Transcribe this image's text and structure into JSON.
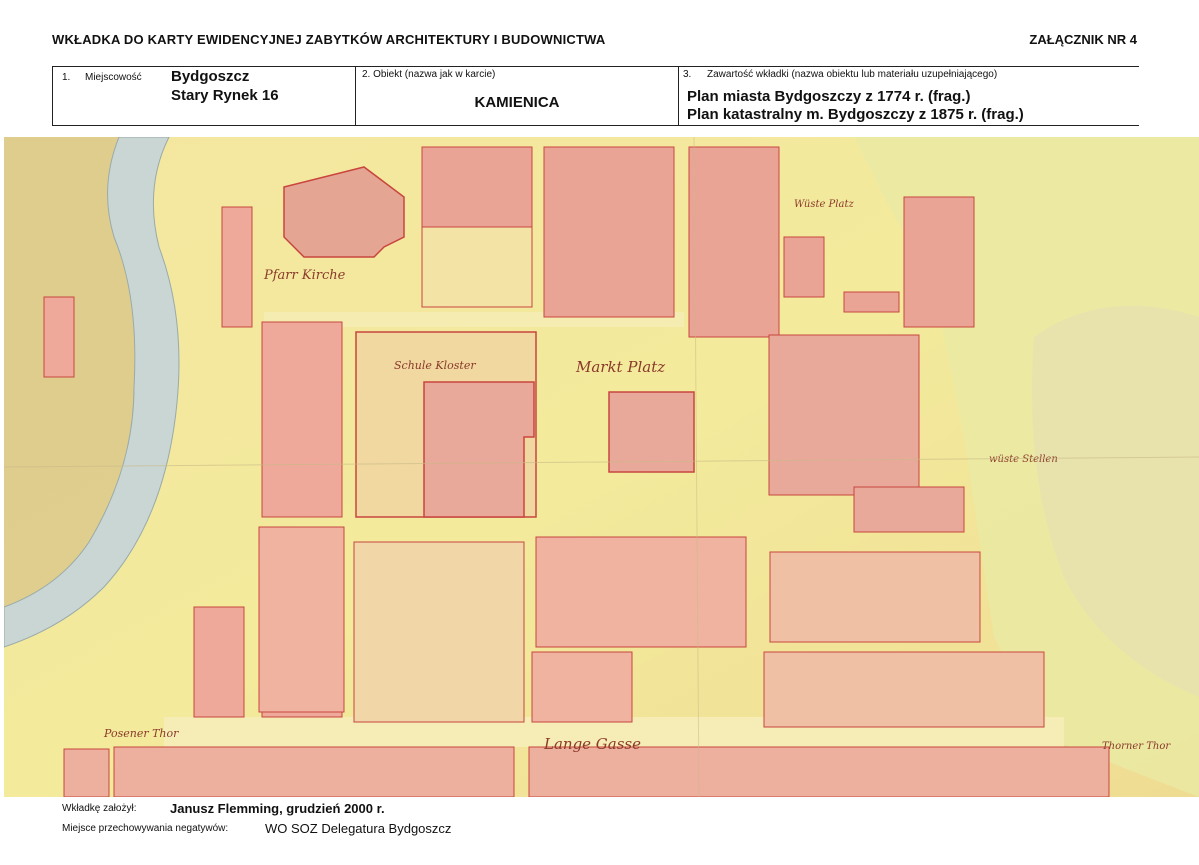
{
  "header": {
    "title": "WKŁADKA DO KARTY EWIDENCYJNEJ ZABYTKÓW ARCHITEKTURY I BUDOWNICTWA",
    "annex": "ZAŁĄCZNIK NR 4"
  },
  "form": {
    "field1": {
      "number": "1.",
      "label": "Miejscowość",
      "value_line1": "Bydgoszcz",
      "value_line2": "Stary Rynek 16"
    },
    "field2": {
      "label": "2. Obiekt (nazwa jak w karcie)",
      "value": "KAMIENICA"
    },
    "field3": {
      "number": "3.",
      "label": "Zawartość wkładki (nazwa obiektu lub materiału uzupełniającego)",
      "value_line1": "Plan miasta Bydgoszczy z 1774 r. (frag.)",
      "value_line2": "Plan katastralny m. Bydgoszczy z 1875 r. (frag.)"
    }
  },
  "map": {
    "labels": {
      "pfarr_kirche": "Pfarr Kirche",
      "markt_platz": "Markt Platz",
      "schule_kloster": "Schule Kloster",
      "lange_gasse": "Lange Gasse",
      "posener_thor": "Posener Thor",
      "thorner_thor": "Thorner Thor",
      "wuste_stellen": "wüste Stellen",
      "wuste_platz": "Wüste Platz"
    },
    "colors": {
      "paper": "#f2e7a2",
      "building": "#e9a99a",
      "outline": "#c8463f",
      "river": "#c9d6d4",
      "riverbank": "#d8c488"
    }
  },
  "footer": {
    "founded_label": "Wkładkę założył:",
    "author": "Janusz Flemming,   grudzień 2000 r.",
    "storage_label": "Miejsce przechowywania negatywów:",
    "storage_value": "WO SOZ Delegatura Bydgoszcz"
  }
}
